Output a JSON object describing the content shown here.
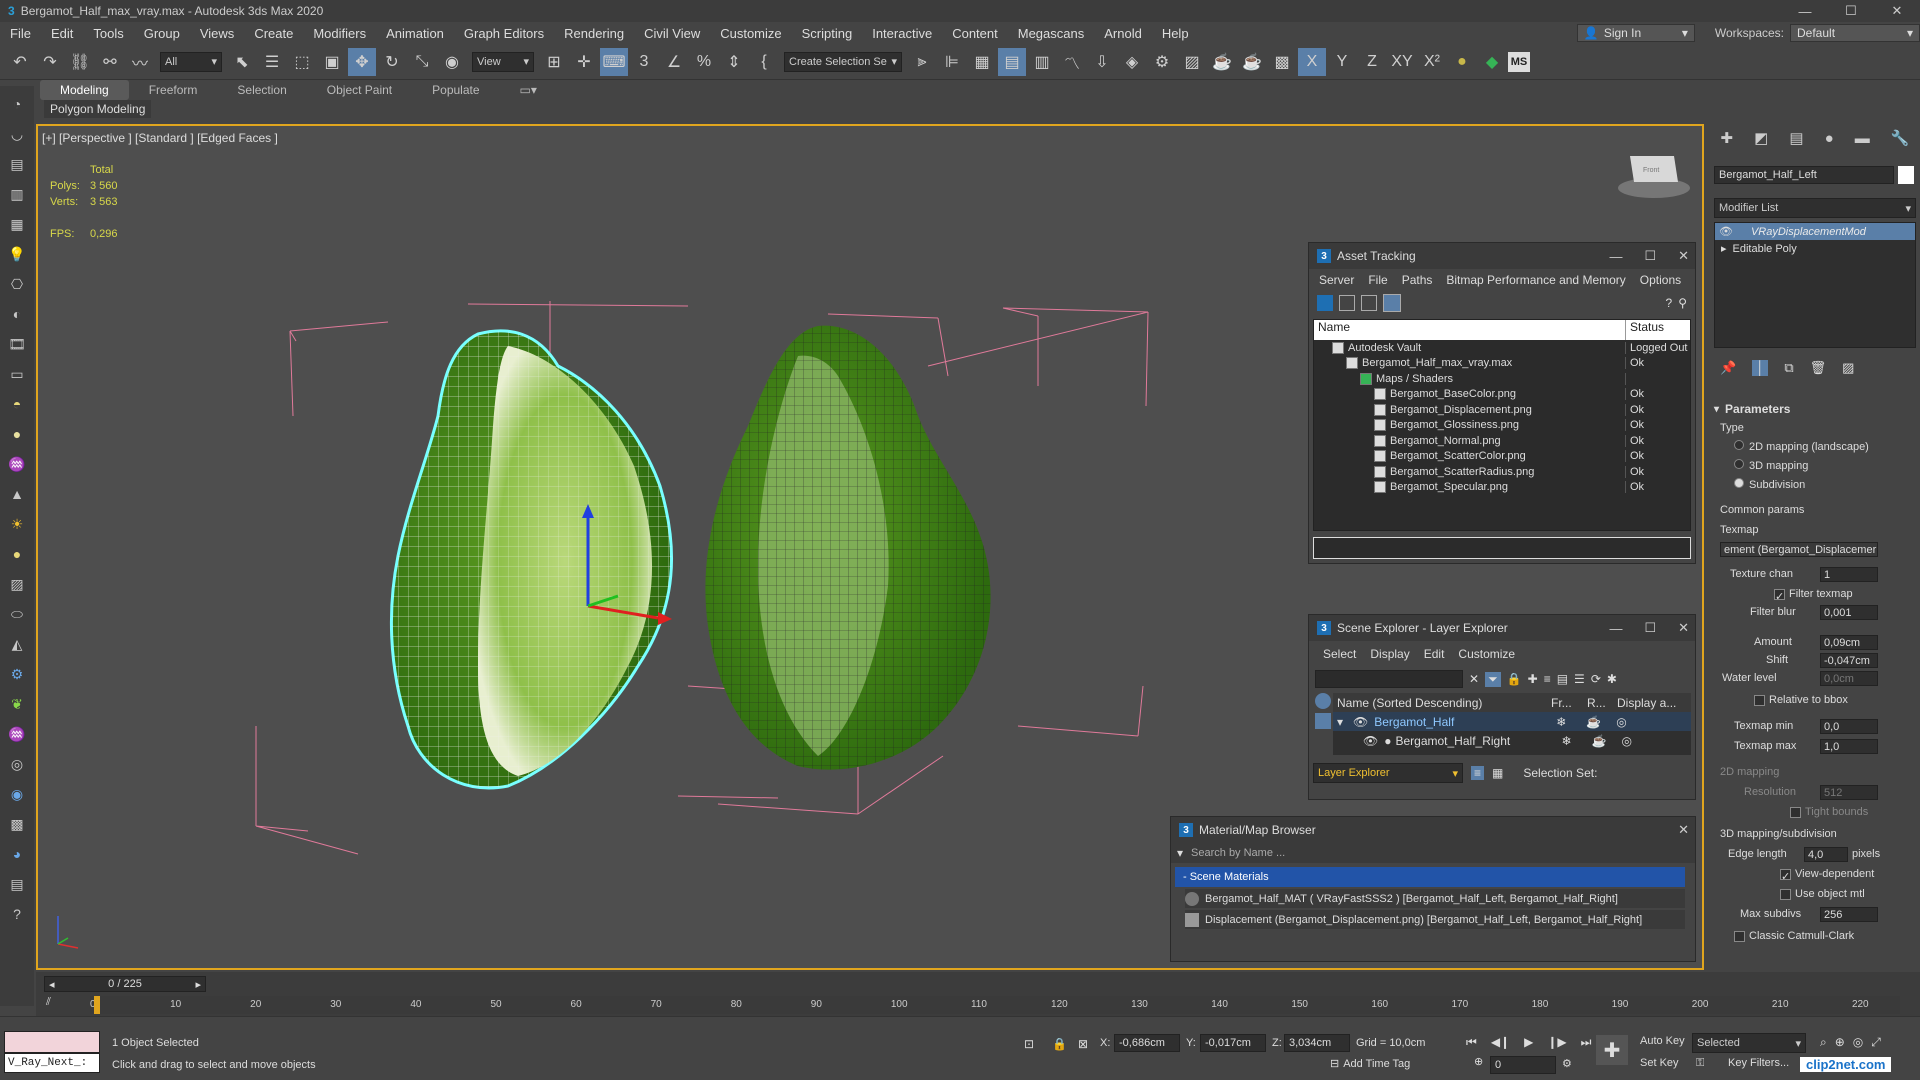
{
  "window": {
    "title": "Bergamot_Half_max_vray.max - Autodesk 3ds Max 2020",
    "minimize": "—",
    "maximize": "☐",
    "close": "✕"
  },
  "menu": {
    "items": [
      "File",
      "Edit",
      "Tools",
      "Group",
      "Views",
      "Create",
      "Modifiers",
      "Animation",
      "Graph Editors",
      "Rendering",
      "Civil View",
      "Customize",
      "Scripting",
      "Interactive",
      "Content",
      "Megascans",
      "Arnold",
      "Help"
    ],
    "sign_in": "Sign In",
    "workspaces_label": "Workspaces:",
    "workspace_value": "Default"
  },
  "toolbar": {
    "filter_value": "All",
    "view_value": "View",
    "selection_set_placeholder": "Create Selection Se",
    "ms_label": "MS"
  },
  "ribbon": {
    "tabs": [
      "Modeling",
      "Freeform",
      "Selection",
      "Object Paint",
      "Populate"
    ],
    "active": "Modeling",
    "sub": "Polygon Modeling"
  },
  "viewport": {
    "label": "[+] [Perspective ] [Standard ] [Edged Faces ]",
    "stats": {
      "total_label": "Total",
      "polys_label": "Polys:",
      "polys": "3 560",
      "verts_label": "Verts:",
      "verts": "3 563",
      "fps_label": "FPS:",
      "fps": "0,296"
    },
    "viewcube_label": "Front"
  },
  "asset_tracking": {
    "title": "Asset Tracking",
    "menu": [
      "Server",
      "File",
      "Paths",
      "Bitmap Performance and Memory",
      "Options"
    ],
    "col_name": "Name",
    "col_status": "Status",
    "rows": [
      {
        "name": "Autodesk Vault",
        "status": "Logged Out",
        "indent": 0
      },
      {
        "name": "Bergamot_Half_max_vray.max",
        "status": "Ok",
        "indent": 1
      },
      {
        "name": "Maps / Shaders",
        "status": "",
        "indent": 2
      },
      {
        "name": "Bergamot_BaseColor.png",
        "status": "Ok",
        "indent": 3
      },
      {
        "name": "Bergamot_Displacement.png",
        "status": "Ok",
        "indent": 3
      },
      {
        "name": "Bergamot_Glossiness.png",
        "status": "Ok",
        "indent": 3
      },
      {
        "name": "Bergamot_Normal.png",
        "status": "Ok",
        "indent": 3
      },
      {
        "name": "Bergamot_ScatterColor.png",
        "status": "Ok",
        "indent": 3
      },
      {
        "name": "Bergamot_ScatterRadius.png",
        "status": "Ok",
        "indent": 3
      },
      {
        "name": "Bergamot_Specular.png",
        "status": "Ok",
        "indent": 3
      }
    ]
  },
  "scene_explorer": {
    "title": "Scene Explorer - Layer Explorer",
    "menu": [
      "Select",
      "Display",
      "Edit",
      "Customize"
    ],
    "col_name": "Name (Sorted Descending)",
    "col_fr": "Fr...",
    "col_r": "R...",
    "col_display": "Display a...",
    "rows": [
      {
        "name": "Bergamot_Half",
        "indent": 0
      },
      {
        "name": "Bergamot_Half_Right",
        "indent": 1
      }
    ],
    "layer_explorer": "Layer Explorer",
    "selection_set": "Selection Set:"
  },
  "material_browser": {
    "title": "Material/Map Browser",
    "search_placeholder": "Search by Name ...",
    "group": "- Scene Materials",
    "items": [
      "Bergamot_Half_MAT ( VRayFastSSS2 ) [Bergamot_Half_Left, Bergamot_Half_Right]",
      "Displacement (Bergamot_Displacement.png) [Bergamot_Half_Left, Bergamot_Half_Right]"
    ]
  },
  "command_panel": {
    "object_name": "Bergamot_Half_Left",
    "modifier_list": "Modifier List",
    "stack": [
      "VRayDisplacementMod",
      "Editable Poly"
    ],
    "parameters": {
      "header": "Parameters",
      "type_label": "Type",
      "type_options": [
        "2D mapping (landscape)",
        "3D mapping",
        "Subdivision"
      ],
      "type_selected": 2,
      "common_params": "Common params",
      "texmap_label": "Texmap",
      "texmap_value": "ement (Bergamot_Displacemer",
      "texture_chan_label": "Texture chan",
      "texture_chan": "1",
      "filter_texmap": "Filter texmap",
      "filter_blur_label": "Filter blur",
      "filter_blur": "0,001",
      "amount_label": "Amount",
      "amount": "0,09cm",
      "shift_label": "Shift",
      "shift": "-0,047cm",
      "water_level_label": "Water level",
      "water_level": "0,0cm",
      "relative_bbox": "Relative to bbox",
      "texmap_min_label": "Texmap min",
      "texmap_min": "0,0",
      "texmap_max_label": "Texmap max",
      "texmap_max": "1,0",
      "mapping2d": "2D mapping",
      "resolution_label": "Resolution",
      "resolution": "512",
      "tight_bounds": "Tight bounds",
      "mapping3d": "3D mapping/subdivision",
      "edge_length_label": "Edge length",
      "edge_length": "4,0",
      "pixels": "pixels",
      "view_dependent": "View-dependent",
      "use_object_mtl": "Use object mtl",
      "max_subdivs_label": "Max subdivs",
      "max_subdivs": "256",
      "classic_cc": "Classic Catmull-Clark"
    }
  },
  "timeline": {
    "frame": "0 / 225",
    "ticks": [
      "0",
      "10",
      "20",
      "30",
      "40",
      "50",
      "60",
      "70",
      "80",
      "90",
      "100",
      "110",
      "120",
      "130",
      "140",
      "150",
      "160",
      "170",
      "180",
      "190",
      "200",
      "210",
      "220"
    ]
  },
  "status": {
    "script_field": "V_Ray_Next_:",
    "selected": "1 Object Selected",
    "prompt": "Click and drag to select and move objects",
    "x_label": "X:",
    "x": "-0,686cm",
    "y_label": "Y:",
    "y": "-0,017cm",
    "z_label": "Z:",
    "z": "3,034cm",
    "grid": "Grid = 10,0cm",
    "add_time_tag": "Add Time Tag",
    "auto_key": "Auto Key",
    "set_key": "Set Key",
    "selected_dd": "Selected",
    "key_filters": "Key Filters...",
    "frame_value": "0",
    "watermark": "clip2net.com"
  }
}
